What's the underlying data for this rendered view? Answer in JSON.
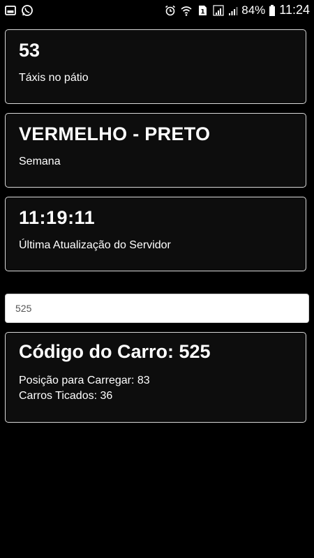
{
  "status_bar": {
    "battery_percent": "84%",
    "time": "11:24",
    "icons": [
      "gallery-icon",
      "whatsapp-icon",
      "alarm-icon",
      "wifi-icon",
      "sim-icon",
      "signal-icon",
      "battery-icon"
    ]
  },
  "cards": {
    "taxis": {
      "value": "53",
      "label": "Táxis no pátio"
    },
    "week": {
      "value": "VERMELHO - PRETO",
      "label": "Semana"
    },
    "update": {
      "value": "11:19:11",
      "label": "Última Atualização do Servidor"
    }
  },
  "search": {
    "value": "525"
  },
  "car_info": {
    "title": "Código do Carro: 525",
    "position": "Posição para Carregar: 83",
    "ticked": "Carros Ticados: 36"
  }
}
